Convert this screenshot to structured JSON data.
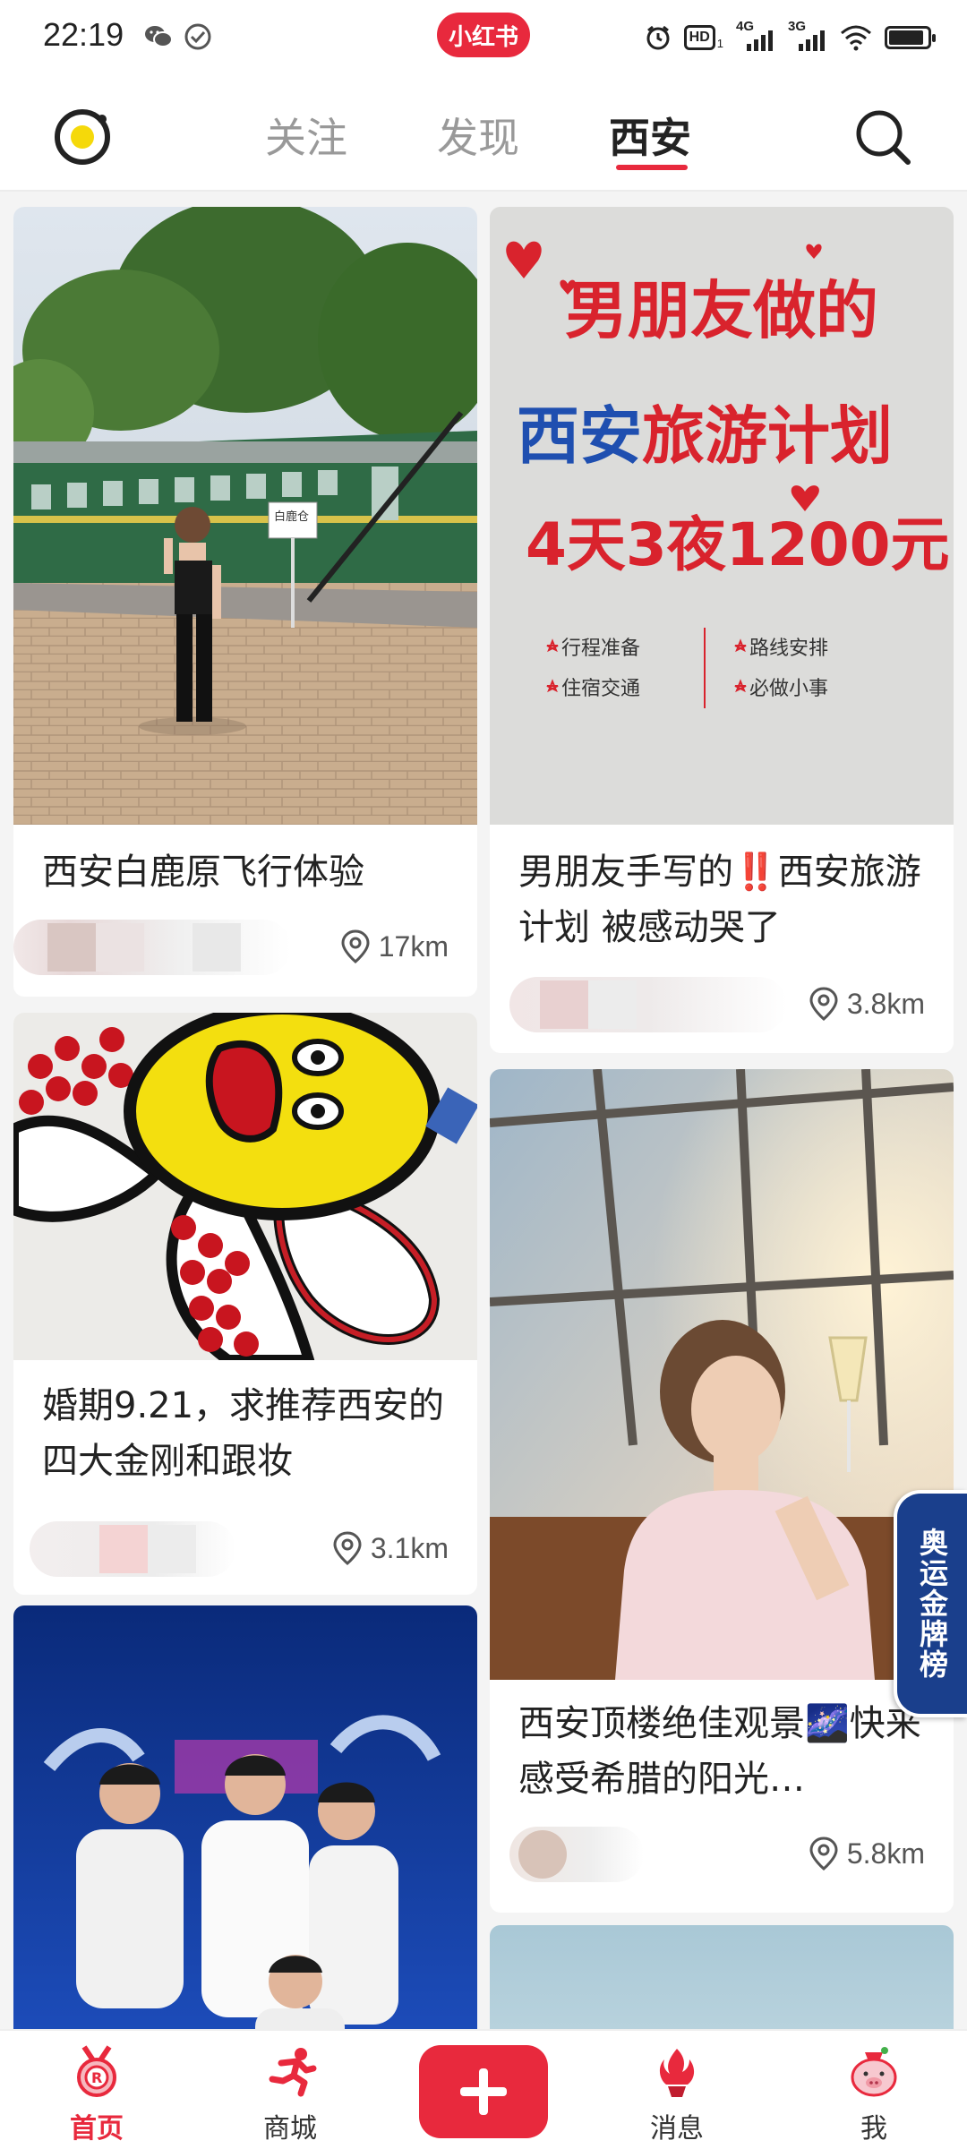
{
  "status_bar": {
    "time": "22:19",
    "app_badge": "小红书",
    "network_a": "4G",
    "network_b": "3G",
    "hd_label": "HD",
    "hd_sub": "1",
    "battery_level": 0.9,
    "icons": [
      "wechat-icon",
      "check-circle-icon",
      "alarm-icon",
      "hd-icon",
      "signal-icon",
      "wifi-icon",
      "battery-icon"
    ]
  },
  "top_nav": {
    "tabs": [
      {
        "label": "关注",
        "active": false
      },
      {
        "label": "发现",
        "active": false
      },
      {
        "label": "西安",
        "active": true
      }
    ]
  },
  "feed": {
    "left": [
      {
        "title": "西安白鹿原飞行体验",
        "distance": "17km"
      },
      {
        "title": "婚期9.21，求推荐西安的四大金刚和跟妆",
        "distance": "3.1km"
      },
      {
        "title": "",
        "distance": ""
      }
    ],
    "right": [
      {
        "title": "男朋友手写的‼️西安旅游计划 被感动哭了",
        "distance": "3.8km"
      },
      {
        "title": "西安顶楼绝佳观景🌌快来感受希腊的阳光…",
        "distance": "5.8km"
      },
      {
        "title": "",
        "distance": ""
      }
    ]
  },
  "poster": {
    "line1": "男朋友做的",
    "line2a": "西安",
    "line2b": "旅游计划",
    "line3": "4天3夜1200元",
    "items": [
      "行程准备",
      "路线安排",
      "住宿交通",
      "必做小事"
    ],
    "sign_text": "白鹿仓"
  },
  "medal_tag": "奥运金牌榜",
  "bottom_nav": {
    "items": [
      {
        "label": "首页",
        "active": true
      },
      {
        "label": "商城",
        "active": false
      },
      {
        "label": "消息",
        "active": false
      },
      {
        "label": "我",
        "active": false
      }
    ]
  },
  "colors": {
    "brand": "#e8293d",
    "text": "#222222",
    "muted": "#999999"
  }
}
